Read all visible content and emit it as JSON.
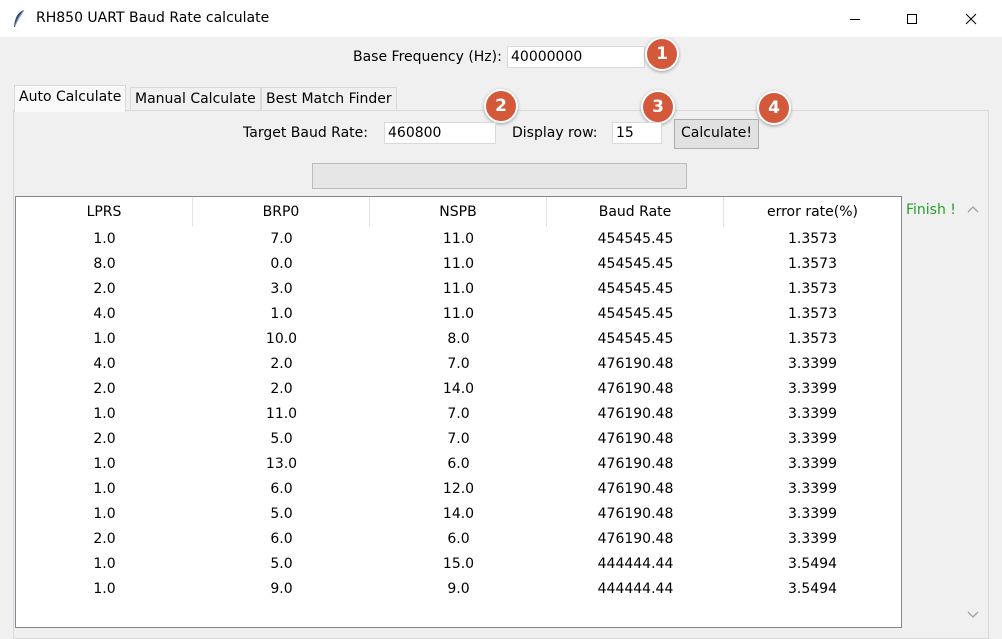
{
  "window": {
    "title": "RH850 UART Baud Rate calculate",
    "icon": "feather-icon"
  },
  "base_frequency": {
    "label": "Base Frequency (Hz):",
    "value": "40000000"
  },
  "tabs": [
    {
      "label": "Auto Calculate",
      "active": true
    },
    {
      "label": "Manual Calculate",
      "active": false
    },
    {
      "label": "Best Match Finder",
      "active": false
    }
  ],
  "target_baud": {
    "label": "Target Baud Rate:",
    "value": "460800"
  },
  "display_row": {
    "label": "Display row:",
    "value": "15"
  },
  "calculate_label": "Calculate!",
  "badges": [
    "1",
    "2",
    "3",
    "4"
  ],
  "status": {
    "text": "Finish !",
    "color": "#22a02b"
  },
  "badge_color": "#d4593b",
  "table": {
    "headers": [
      "LPRS",
      "BRP0",
      "NSPB",
      "Baud Rate",
      "error rate(%)"
    ],
    "rows": [
      [
        "1.0",
        "7.0",
        "11.0",
        "454545.45",
        "1.3573"
      ],
      [
        "8.0",
        "0.0",
        "11.0",
        "454545.45",
        "1.3573"
      ],
      [
        "2.0",
        "3.0",
        "11.0",
        "454545.45",
        "1.3573"
      ],
      [
        "4.0",
        "1.0",
        "11.0",
        "454545.45",
        "1.3573"
      ],
      [
        "1.0",
        "10.0",
        "8.0",
        "454545.45",
        "1.3573"
      ],
      [
        "4.0",
        "2.0",
        "7.0",
        "476190.48",
        "3.3399"
      ],
      [
        "2.0",
        "2.0",
        "14.0",
        "476190.48",
        "3.3399"
      ],
      [
        "1.0",
        "11.0",
        "7.0",
        "476190.48",
        "3.3399"
      ],
      [
        "2.0",
        "5.0",
        "7.0",
        "476190.48",
        "3.3399"
      ],
      [
        "1.0",
        "13.0",
        "6.0",
        "476190.48",
        "3.3399"
      ],
      [
        "1.0",
        "6.0",
        "12.0",
        "476190.48",
        "3.3399"
      ],
      [
        "1.0",
        "5.0",
        "14.0",
        "476190.48",
        "3.3399"
      ],
      [
        "2.0",
        "6.0",
        "6.0",
        "476190.48",
        "3.3399"
      ],
      [
        "1.0",
        "5.0",
        "15.0",
        "444444.44",
        "3.5494"
      ],
      [
        "1.0",
        "9.0",
        "9.0",
        "444444.44",
        "3.5494"
      ]
    ]
  }
}
